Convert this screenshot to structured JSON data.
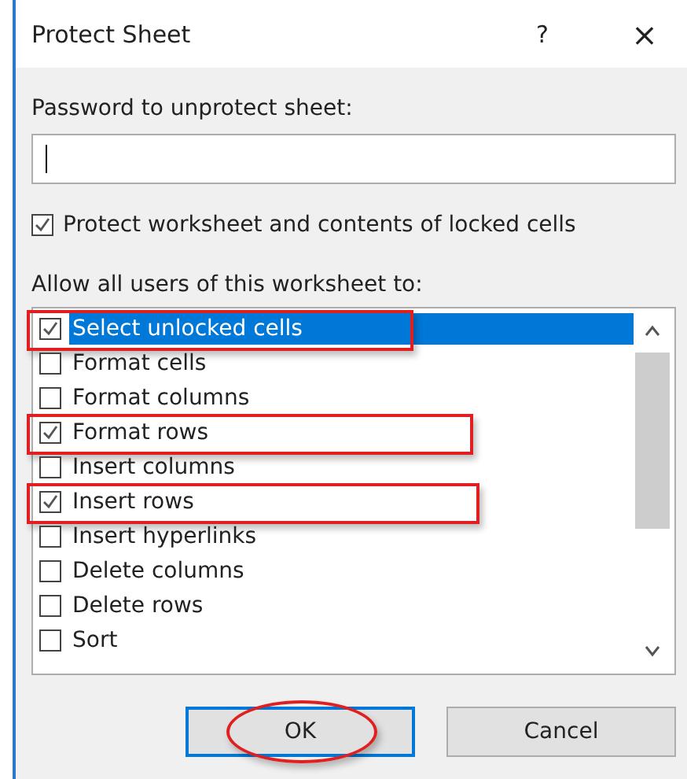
{
  "window": {
    "title": "Protect Sheet",
    "help": "?",
    "close": "×"
  },
  "password": {
    "label": "Password to unprotect sheet:"
  },
  "protect_checkbox": {
    "label": "Protect worksheet and contents of locked cells",
    "checked": true
  },
  "permissions": {
    "label": "Allow all users of this worksheet to:",
    "items": [
      {
        "label": "Select unlocked cells",
        "checked": true,
        "selected": true,
        "highlighted": true
      },
      {
        "label": "Format cells",
        "checked": false,
        "selected": false,
        "highlighted": false
      },
      {
        "label": "Format columns",
        "checked": false,
        "selected": false,
        "highlighted": false
      },
      {
        "label": "Format rows",
        "checked": true,
        "selected": false,
        "highlighted": true
      },
      {
        "label": "Insert columns",
        "checked": false,
        "selected": false,
        "highlighted": false
      },
      {
        "label": "Insert rows",
        "checked": true,
        "selected": false,
        "highlighted": true
      },
      {
        "label": "Insert hyperlinks",
        "checked": false,
        "selected": false,
        "highlighted": false
      },
      {
        "label": "Delete columns",
        "checked": false,
        "selected": false,
        "highlighted": false
      },
      {
        "label": "Delete rows",
        "checked": false,
        "selected": false,
        "highlighted": false
      },
      {
        "label": "Sort",
        "checked": false,
        "selected": false,
        "highlighted": false
      }
    ]
  },
  "buttons": [
    {
      "label": "OK",
      "default": true,
      "circled": true
    },
    {
      "label": "Cancel",
      "default": false,
      "circled": false
    }
  ]
}
